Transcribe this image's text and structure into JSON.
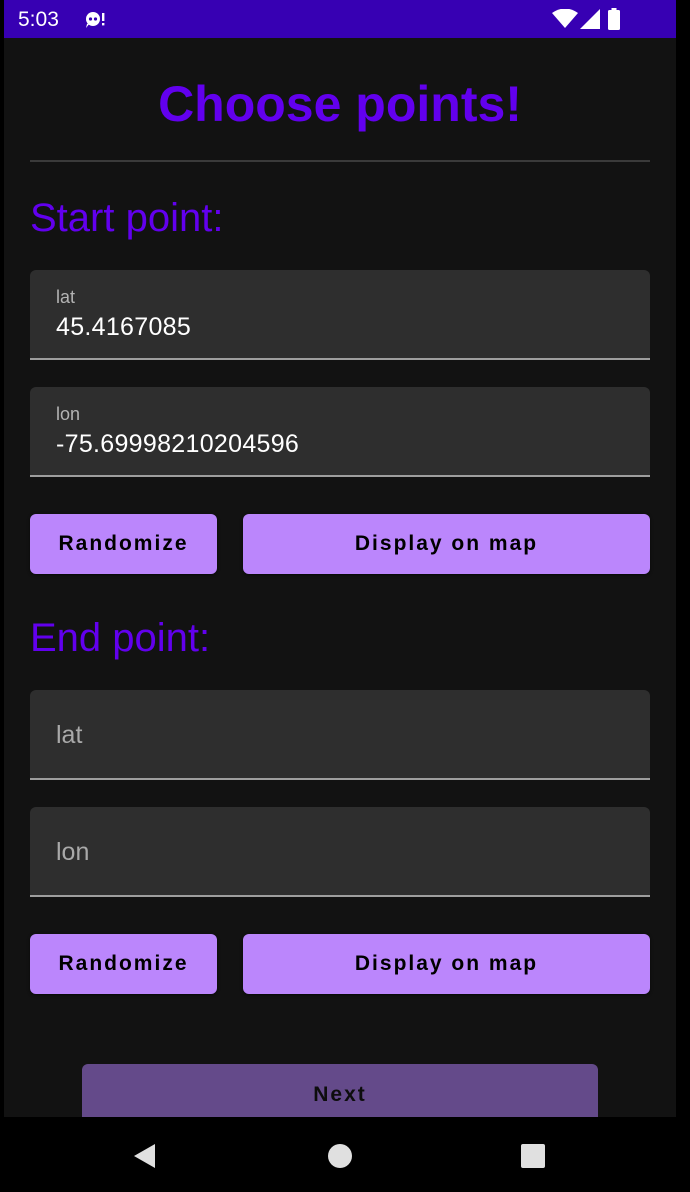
{
  "status_bar": {
    "time": "5:03",
    "notification_icon": "assistant-notification-icon",
    "icons": [
      "wifi-icon",
      "cell-signal-icon",
      "battery-icon"
    ],
    "background_color": "#3700b3"
  },
  "page": {
    "title": "Choose points!"
  },
  "start_point": {
    "heading": "Start point:",
    "lat": {
      "label": "lat",
      "value": "45.4167085"
    },
    "lon": {
      "label": "lon",
      "value": "-75.69998210204596"
    },
    "randomize_label": "Randomize",
    "display_label": "Display on map"
  },
  "end_point": {
    "heading": "End point:",
    "lat": {
      "placeholder": "lat",
      "value": ""
    },
    "lon": {
      "placeholder": "lon",
      "value": ""
    },
    "randomize_label": "Randomize",
    "display_label": "Display on map"
  },
  "footer": {
    "next_label": "Next"
  },
  "nav_bar": {
    "icons": [
      "back-icon",
      "home-icon",
      "recents-icon"
    ]
  },
  "colors": {
    "accent": "#6200ee",
    "button": "#bb86fc",
    "button_disabled": "#644a8a",
    "surface": "#121212",
    "field": "#2e2e2e"
  }
}
